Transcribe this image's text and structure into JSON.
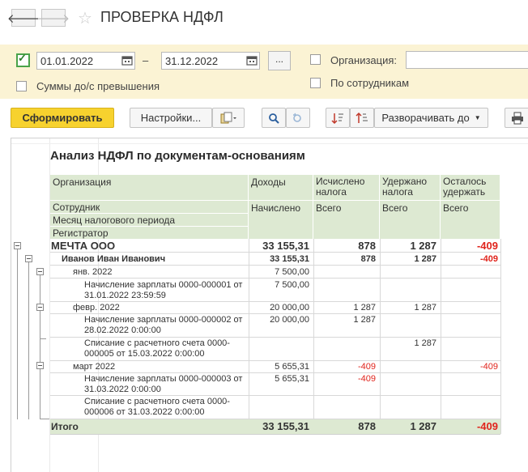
{
  "window": {
    "title": "ПРОВЕРКА НДФЛ"
  },
  "params": {
    "period_from": "01.01.2022",
    "period_dash": "–",
    "period_to": "31.12.2022",
    "dots_label": "...",
    "org_label": "Организация:",
    "org_value": "",
    "excess_label": "Суммы до/с превышения",
    "by_employee_label": "По сотрудникам"
  },
  "toolbar": {
    "generate": "Сформировать",
    "settings": "Настройки...",
    "expand_to": "Разворачивать до"
  },
  "report": {
    "title": "Анализ НДФЛ по документам-основаниям",
    "headers": {
      "org": "Организация",
      "employee": "Сотрудник",
      "month": "Месяц налогового периода",
      "registrar": "Регистратор",
      "income": "Доходы",
      "income_sub": "Начислено",
      "calc": "Исчислено налога",
      "calc_sub": "Всего",
      "withheld": "Удержано налога",
      "withheld_sub": "Всего",
      "remain": "Осталось удержать",
      "remain_sub": "Всего"
    },
    "rows": [
      {
        "label": "МЕЧТА ООО",
        "income": "33 155,31",
        "calc": "878",
        "withheld": "1 287",
        "remain": "-409"
      },
      {
        "label": "Иванов Иван Иванович",
        "income": "33 155,31",
        "calc": "878",
        "withheld": "1 287",
        "remain": "-409"
      },
      {
        "label": "янв. 2022",
        "income": "7 500,00",
        "calc": "",
        "withheld": "",
        "remain": ""
      },
      {
        "label": "Начисление зарплаты 0000-000001 от 31.01.2022 23:59:59",
        "income": "7 500,00",
        "calc": "",
        "withheld": "",
        "remain": ""
      },
      {
        "label": "февр. 2022",
        "income": "20 000,00",
        "calc": "1 287",
        "withheld": "1 287",
        "remain": ""
      },
      {
        "label": "Начисление зарплаты 0000-000002 от 28.02.2022 0:00:00",
        "income": "20 000,00",
        "calc": "1 287",
        "withheld": "",
        "remain": ""
      },
      {
        "label": "Списание с расчетного счета 0000-000005 от 15.03.2022 0:00:00",
        "income": "",
        "calc": "",
        "withheld": "1 287",
        "remain": ""
      },
      {
        "label": "март 2022",
        "income": "5 655,31",
        "calc": "-409",
        "withheld": "",
        "remain": "-409"
      },
      {
        "label": "Начисление зарплаты 0000-000003 от 31.03.2022 0:00:00",
        "income": "5 655,31",
        "calc": "-409",
        "withheld": "",
        "remain": ""
      },
      {
        "label": "Списание с расчетного счета 0000-000006 от 31.03.2022 0:00:00",
        "income": "",
        "calc": "",
        "withheld": "",
        "remain": ""
      }
    ],
    "total": {
      "label": "Итого",
      "income": "33 155,31",
      "calc": "878",
      "withheld": "1 287",
      "remain": "-409"
    }
  },
  "colors": {
    "accent": "#f7d22e",
    "header_bg": "#dde9d2",
    "panel_bg": "#fbf3d4",
    "negative": "#e0241c"
  },
  "icons": [
    "back-arrow-icon",
    "forward-arrow-icon",
    "star-icon",
    "calendar-icon",
    "variants-icon",
    "search-icon",
    "clear-search-icon",
    "sort-asc-icon",
    "sort-desc-icon",
    "print-icon"
  ]
}
